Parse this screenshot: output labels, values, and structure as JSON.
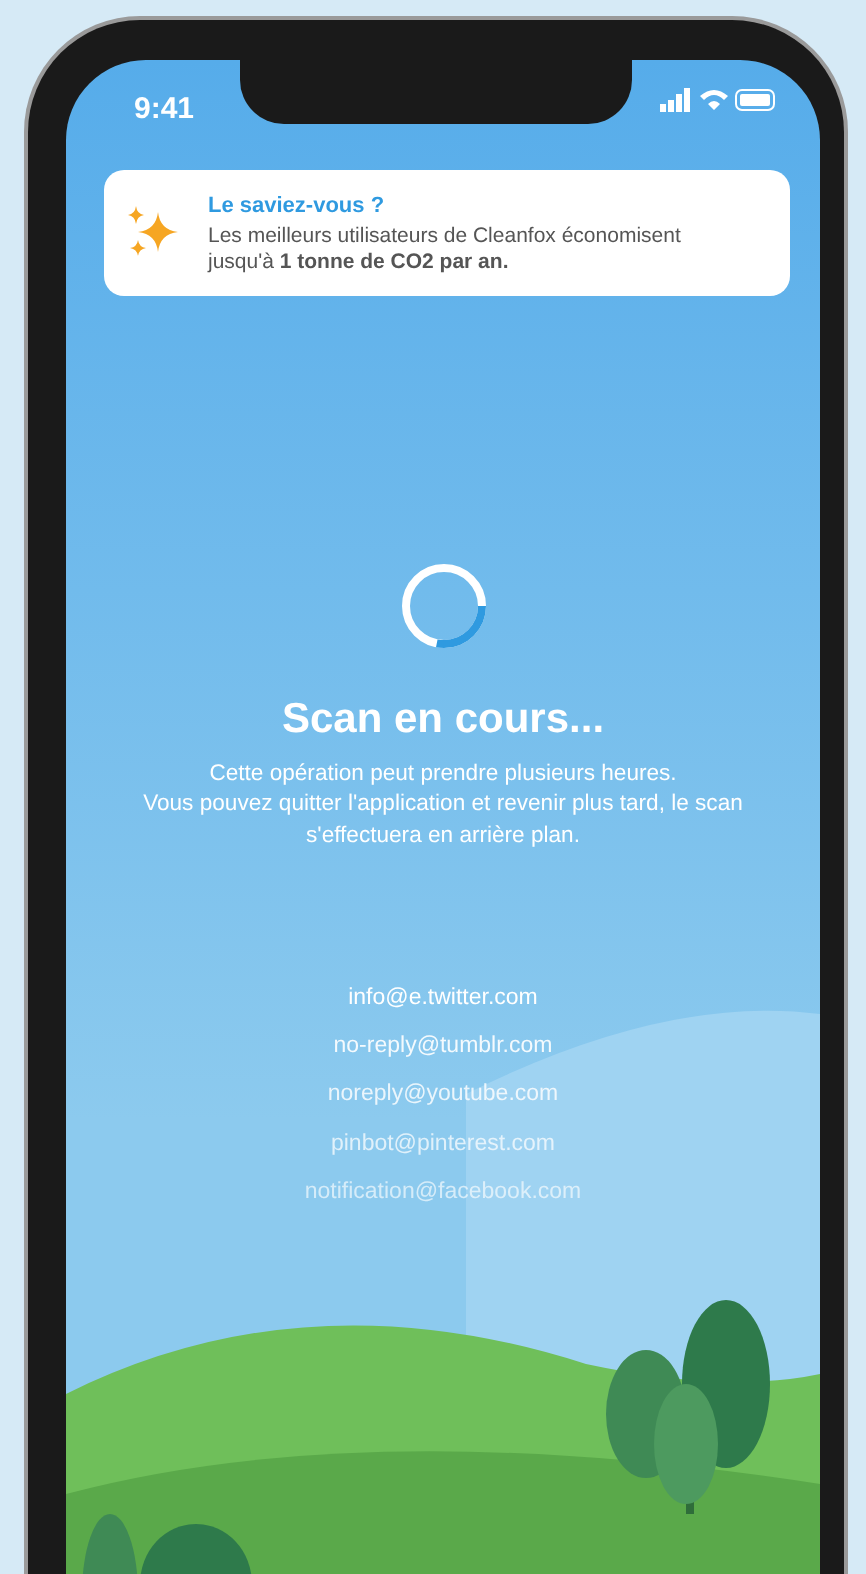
{
  "status_bar": {
    "time": "9:41"
  },
  "tip": {
    "title": "Le saviez-vous ?",
    "text": "Les meilleurs utilisateurs de Cleanfox économisent jusqu'à **1 tonne de CO2 par an.**"
  },
  "scan": {
    "level": 0.28,
    "title": "Scan en cours...",
    "description": "Cette opération peut prendre plusieurs heures.\nVous pouvez quitter l'application et revenir plus tard, le scan s'effectuera en arrière plan."
  },
  "senders": [
    "info@e.twitter.com",
    "no-reply@tumblr.com",
    "noreply@youtube.com",
    "pinbot@pinterest.com",
    "notification@facebook.com"
  ]
}
